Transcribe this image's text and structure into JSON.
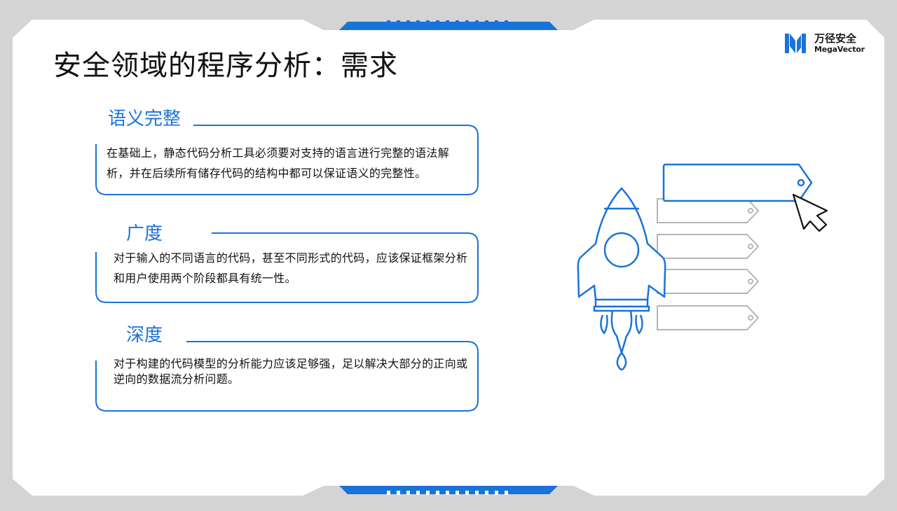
{
  "slide": {
    "title": "安全领域的程序分析：需求"
  },
  "logo": {
    "name_cn": "万径安全",
    "name_en": "MegaVector"
  },
  "requirements": [
    {
      "title": "语义完整",
      "description": "在基础上，静态代码分析工具必须要对支持的语言进行完整的语法解析，并在后续所有储存代码的结构中都可以保证语义的完整性。"
    },
    {
      "title": "广度",
      "description": "对于输入的不同语言的代码，甚至不同形式的代码，应该保证框架分析和用户使用两个阶段都具有统一性。"
    },
    {
      "title": "深度",
      "description": "对于构建的代码模型的分析能力应该足够强，足以解决大部分的正向或逆向的数据流分析问题。"
    }
  ],
  "colors": {
    "accent": "#1a73d9",
    "frame": "#d4d4d4",
    "slide_background": "#ffffff",
    "tag_outline": "#b5b5b5",
    "text": "#111111"
  },
  "icons": [
    "rocket-icon",
    "tag-icon",
    "cursor-arrow-icon",
    "logo-mark-icon"
  ]
}
